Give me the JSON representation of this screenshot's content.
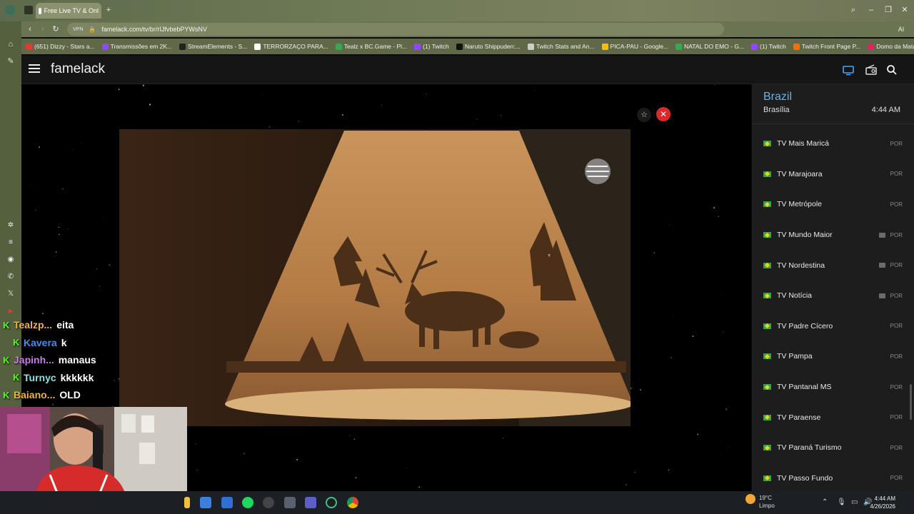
{
  "browser": {
    "tab_title": "Free Live TV & Onl",
    "url": "famelack.com/tv/br/rIJfvbebPYWsNV",
    "vpn_label": "VPN",
    "ai_label": "AI",
    "bookmarks": [
      {
        "label": "(651) Dizzy - Stars a...",
        "color": "#e53935"
      },
      {
        "label": "Transmissões em 2K...",
        "color": "#9146ff"
      },
      {
        "label": "StreamElements - S...",
        "color": "#222222"
      },
      {
        "label": "TERRORZAÇO PARA...",
        "color": "#ffffff"
      },
      {
        "label": "Tealz x BC.Game - Pl...",
        "color": "#34a853"
      },
      {
        "label": "(1) Twitch",
        "color": "#9146ff"
      },
      {
        "label": "Naruto Shippuden:...",
        "color": "#111111"
      },
      {
        "label": "Twitch Stats and An...",
        "color": "#cccccc"
      },
      {
        "label": "PICA-PAU - Google...",
        "color": "#fbbc04"
      },
      {
        "label": "NATAL DO EMO - G...",
        "color": "#34a853"
      },
      {
        "label": "(1) Twitch",
        "color": "#9146ff"
      },
      {
        "label": "Twitch Front Page P...",
        "color": "#ff6d00"
      },
      {
        "label": "Domo da Mata - Ho...",
        "color": "#e91e63"
      }
    ]
  },
  "app": {
    "brand": "famelack"
  },
  "panel": {
    "country": "Brazil",
    "capital": "Brasília",
    "time": "4:44 AM",
    "channels": [
      {
        "name": "TV Mais Maricá",
        "lang": "POR",
        "tv": false
      },
      {
        "name": "TV Marajoara",
        "lang": "POR",
        "tv": false
      },
      {
        "name": "TV Metrópole",
        "lang": "POR",
        "tv": false
      },
      {
        "name": "TV Mundo Maior",
        "lang": "POR",
        "tv": true
      },
      {
        "name": "TV Nordestina",
        "lang": "POR",
        "tv": true
      },
      {
        "name": "TV Notícia",
        "lang": "POR",
        "tv": true
      },
      {
        "name": "TV Padre Cícero",
        "lang": "POR",
        "tv": false
      },
      {
        "name": "TV Pampa",
        "lang": "POR",
        "tv": false
      },
      {
        "name": "TV Pantanal MS",
        "lang": "POR",
        "tv": false
      },
      {
        "name": "TV Paraense",
        "lang": "POR",
        "tv": false
      },
      {
        "name": "TV Paraná Turismo",
        "lang": "POR",
        "tv": false
      },
      {
        "name": "TV Passo Fundo",
        "lang": "POR",
        "tv": false
      }
    ]
  },
  "chat": [
    {
      "user": "Tealzp...",
      "color": "#f0b43c",
      "msg": "eita",
      "badge": "K"
    },
    {
      "user": "Kavera",
      "color": "#3f8fe6",
      "msg": "k",
      "badge": "K"
    },
    {
      "user": "Japinh...",
      "color": "#c77be8",
      "msg": "manaus",
      "badge": "K"
    },
    {
      "user": "Turnyc",
      "color": "#7ee6e6",
      "msg": "kkkkkk",
      "badge": "K"
    },
    {
      "user": "Baiano...",
      "color": "#f0b43c",
      "msg": "OLD",
      "badge": "K"
    }
  ],
  "taskbar": {
    "temperature": "19°C",
    "weather": "Limpo",
    "time": "4:44 AM",
    "date": "4/26/2026"
  }
}
